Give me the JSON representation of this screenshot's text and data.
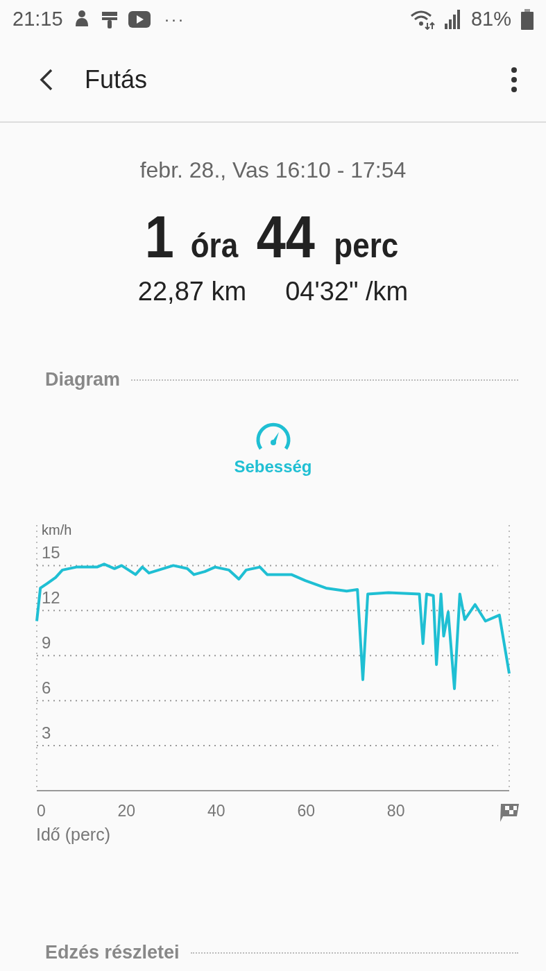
{
  "status_bar": {
    "time": "21:15",
    "more": "···",
    "battery": "81%"
  },
  "app_bar": {
    "title": "Futás"
  },
  "summary": {
    "date": "febr. 28., Vas 16:10 - 17:54",
    "duration": [
      {
        "value": "1",
        "unit": "óra"
      },
      {
        "value": "44",
        "unit": "perc"
      }
    ],
    "stats": [
      "22,87 km",
      "04'32\" /km"
    ]
  },
  "diagram": {
    "heading": "Diagram",
    "chart_data": {
      "type": "line",
      "ylabel": "km/h",
      "xlabel": "Idő (perc)",
      "xlim": [
        0,
        105.2
      ],
      "ylim": [
        0,
        17.7
      ],
      "xticks": [
        0,
        20,
        40,
        60,
        80
      ],
      "yticks": [
        3,
        6,
        9,
        12,
        15
      ],
      "grid": true,
      "x": [
        0,
        0.8,
        2.3,
        4.2,
        5.7,
        8.8,
        13.4,
        15,
        17.3,
        18.9,
        22,
        23.5,
        25,
        30.4,
        33.5,
        35,
        37.4,
        39.7,
        42.8,
        45,
        46.6,
        49.7,
        51.3,
        56.7,
        59.8,
        64.4,
        69,
        71.4,
        72.6,
        73.7,
        78.3,
        85.2,
        86,
        86.8,
        88.3,
        89,
        90,
        90.6,
        91.6,
        93,
        94.2,
        95.3,
        97.6,
        99.9,
        103,
        105.2
      ],
      "series": [
        {
          "name": "Sebesség",
          "color": "#1fbfd3",
          "values": [
            11.3,
            13.5,
            13.8,
            14.2,
            14.7,
            14.9,
            14.9,
            15.1,
            14.8,
            15,
            14.4,
            14.9,
            14.5,
            15,
            14.8,
            14.4,
            14.6,
            14.9,
            14.7,
            14.1,
            14.7,
            14.9,
            14.4,
            14.4,
            14,
            13.5,
            13.3,
            13.4,
            7.4,
            13.1,
            13.2,
            13.1,
            9.8,
            13.1,
            13,
            8.4,
            13.1,
            10.3,
            11.9,
            6.8,
            13.1,
            11.4,
            12.4,
            11.3,
            11.7,
            7.8
          ]
        }
      ]
    }
  },
  "details": {
    "heading": "Edzés részletei"
  }
}
